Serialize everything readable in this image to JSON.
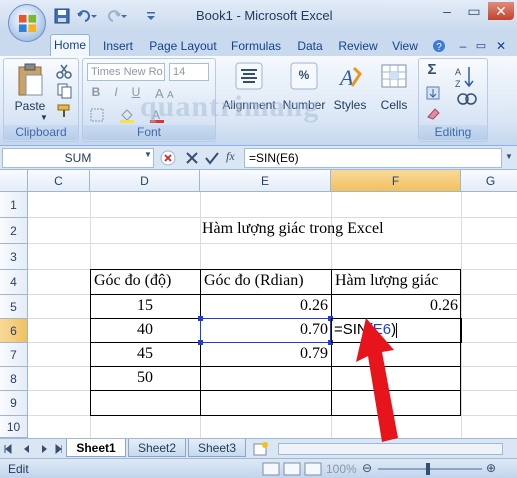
{
  "window": {
    "title": "Book1 - Microsoft Excel",
    "minimize": "–",
    "restore": "▭",
    "close": "✕"
  },
  "qat": {
    "save_icon": "save-icon",
    "undo_icon": "undo-icon",
    "redo_icon": "redo-icon"
  },
  "tabs": [
    {
      "label": "Home"
    },
    {
      "label": "Insert"
    },
    {
      "label": "Page Layout"
    },
    {
      "label": "Formulas"
    },
    {
      "label": "Data"
    },
    {
      "label": "Review"
    },
    {
      "label": "View"
    }
  ],
  "ribbon": {
    "clipboard": {
      "paste": "Paste",
      "label": "Clipboard"
    },
    "font": {
      "name": "Times New Ro",
      "size": "14",
      "label": "Font",
      "bold": "B",
      "italic": "I",
      "underline": "U"
    },
    "alignment": "Alignment",
    "number": "Number",
    "number_symbol": "%",
    "styles": "Styles",
    "cells": "Cells",
    "editing": "Editing",
    "sigma": "Σ"
  },
  "watermark": "quantrimang",
  "formula_bar": {
    "name_box": "SUM",
    "fx": "fx",
    "formula": "=SIN(E6)"
  },
  "columns": [
    "C",
    "D",
    "E",
    "F",
    "G"
  ],
  "rows": [
    "1",
    "2",
    "3",
    "4",
    "5",
    "6",
    "7",
    "8",
    "9",
    "10"
  ],
  "sheet": {
    "title": "Hàm lượng giác trong Excel",
    "headers": [
      "Góc đo (độ)",
      "Góc đo (Rdian)",
      "Hàm lượng giác"
    ],
    "d": [
      "15",
      "40",
      "45",
      "50"
    ],
    "e": [
      "0.26",
      "0.70",
      "0.79"
    ],
    "f5": "0.26",
    "f6_prefix": "=SIN(",
    "f6_ref": "E6",
    "f6_suffix": ")"
  },
  "sheet_tabs": [
    "Sheet1",
    "Sheet2",
    "Sheet3"
  ],
  "status": {
    "mode": "Edit",
    "zoom": "100%"
  },
  "colors": {
    "ref_blue": "#1f3fd4",
    "arrow_red": "#e8141b"
  }
}
